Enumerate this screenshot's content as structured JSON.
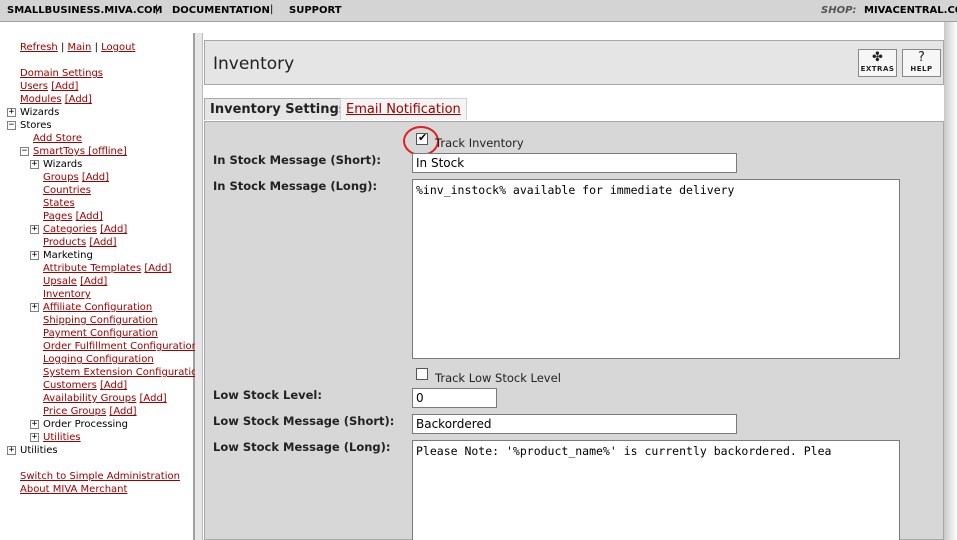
{
  "topbar": {
    "site": "SMALLBUSINESS.MIVA.COM",
    "documentation": "DOCUMENTATION",
    "support": "SUPPORT",
    "shop_label": "SHOP:",
    "shop_value": "MIVACENTRAL.CO"
  },
  "nav": {
    "refresh": "Refresh",
    "main": "Main",
    "logout": "Logout",
    "domain_settings": "Domain Settings",
    "users": "Users",
    "modules": "Modules",
    "add": "[Add]",
    "wizards": "Wizards",
    "stores": "Stores",
    "add_store": "Add Store",
    "store_name": "SmartToys [offline]",
    "store_items": {
      "wizards": "Wizards",
      "groups": "Groups",
      "countries": "Countries",
      "states": "States",
      "pages": "Pages",
      "categories": "Categories",
      "products": "Products",
      "marketing": "Marketing",
      "attribute_templates": "Attribute Templates",
      "upsale": "Upsale",
      "inventory": "Inventory",
      "affiliate_configuration": "Affiliate Configuration",
      "shipping_configuration": "Shipping Configuration",
      "payment_configuration": "Payment Configuration",
      "order_fulfillment_configuration": "Order Fulfillment Configuration",
      "logging_configuration": "Logging Configuration",
      "system_extension_configuration": "System Extension Configuratior",
      "customers": "Customers",
      "availability_groups": "Availability Groups",
      "price_groups": "Price Groups",
      "order_processing": "Order Processing",
      "utilities": "Utilities"
    },
    "utilities": "Utilities",
    "switch_simple": "Switch to Simple Administration",
    "about": "About MIVA Merchant"
  },
  "main": {
    "title": "Inventory",
    "extras_label": "EXTRAS",
    "help_label": "HELP",
    "help_icon": "?",
    "tabs": [
      {
        "label": "Inventory Settings",
        "active": true
      },
      {
        "label": "Email Notification",
        "active": false
      }
    ],
    "form": {
      "track_inventory_label": "Track Inventory",
      "track_inventory_checked": true,
      "in_stock_short_label": "In Stock Message (Short):",
      "in_stock_short_value": "In Stock",
      "in_stock_long_label": "In Stock Message (Long):",
      "in_stock_long_value": "%inv_instock% available for immediate delivery",
      "track_low_stock_label": "Track Low Stock Level",
      "track_low_stock_checked": false,
      "low_stock_level_label": "Low Stock Level:",
      "low_stock_level_value": "0",
      "low_stock_short_label": "Low Stock Message (Short):",
      "low_stock_short_value": "Backordered",
      "low_stock_long_label": "Low Stock Message (Long):",
      "low_stock_long_value": "Please Note: '%product_name%' is currently backordered. Plea"
    }
  },
  "colors": {
    "link": "#a00000",
    "panel": "#d7d7d7",
    "highlight_ring": "#e02020"
  }
}
